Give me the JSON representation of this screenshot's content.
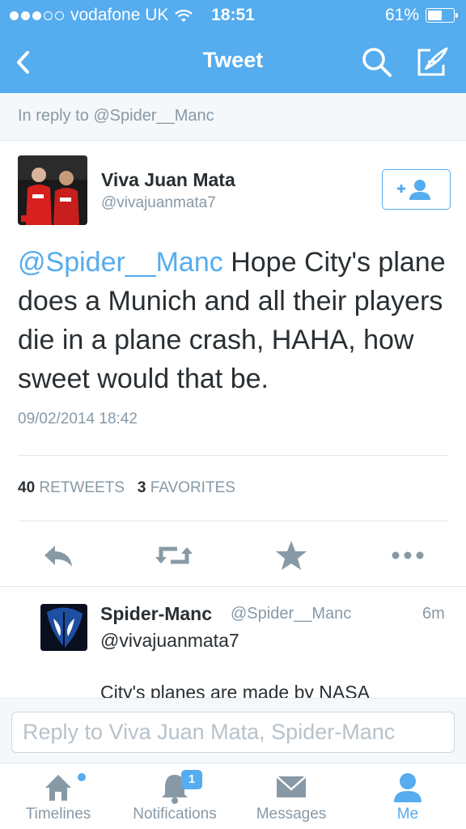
{
  "status_bar": {
    "carrier": "vodafone UK",
    "time": "18:51",
    "battery": "61%",
    "battery_level": 0.61,
    "signal_bars": 3
  },
  "nav": {
    "title": "Tweet",
    "back_icon": "chevron-left-icon",
    "search_icon": "search-icon",
    "compose_icon": "compose-icon"
  },
  "reply_context": "In reply to @Spider__Manc",
  "tweet": {
    "author_name": "Viva Juan Mata",
    "author_handle": "@vivajuanmata7",
    "mention": "@Spider__Manc",
    "text": " Hope City's plane does a Munich and all their players die in a plane crash, HAHA, how sweet would that be.",
    "timestamp": "09/02/2014 18:42",
    "retweets_count": "40",
    "retweets_label": "RETWEETS",
    "favorites_count": "3",
    "favorites_label": "FAVORITES"
  },
  "actions": [
    "reply-icon",
    "retweet-icon",
    "favorite-star-icon",
    "more-icon"
  ],
  "reply": {
    "author_name": "Spider-Manc",
    "author_handle": "@Spider__Manc",
    "time": "6m",
    "line1": "@vivajuanmata7",
    "line2": "City's planes are made by NASA"
  },
  "compose": {
    "placeholder": "Reply to Viva Juan Mata, Spider-Manc"
  },
  "tabs": [
    {
      "label": "Timelines",
      "icon": "home-icon"
    },
    {
      "label": "Notifications",
      "icon": "bell-icon",
      "badge": "1"
    },
    {
      "label": "Messages",
      "icon": "envelope-icon"
    },
    {
      "label": "Me",
      "icon": "person-icon"
    }
  ],
  "colors": {
    "accent": "#55acee",
    "text": "#292f33",
    "muted": "#8899a6"
  }
}
